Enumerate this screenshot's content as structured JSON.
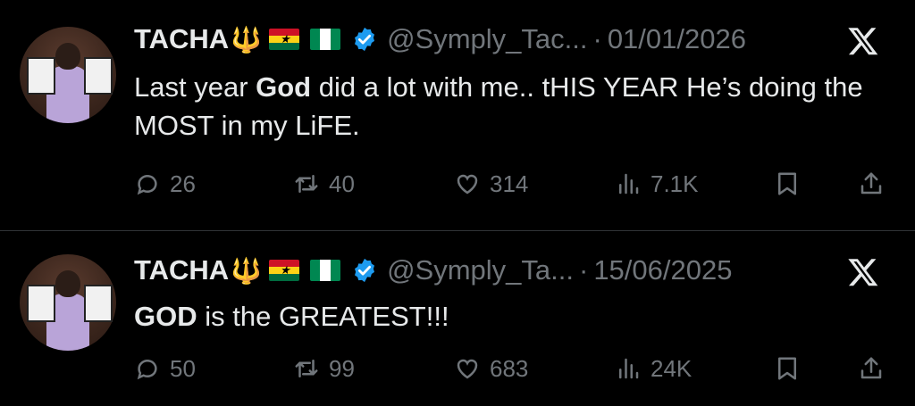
{
  "tweets": [
    {
      "name": "TACHA",
      "emoji": {
        "trident": "🔱"
      },
      "handle": "@Symply_Tac...",
      "separator": "·",
      "date": "01/01/2026",
      "text_parts": [
        {
          "t": "Last year ",
          "b": false
        },
        {
          "t": "God",
          "b": true
        },
        {
          "t": " did a lot with me.. tHIS YEAR He’s doing the MOST in my LiFE.",
          "b": false
        }
      ],
      "replies": "26",
      "reposts": "40",
      "likes": "314",
      "views": "7.1K"
    },
    {
      "name": "TACHA",
      "emoji": {
        "trident": "🔱"
      },
      "handle": "@Symply_Ta...",
      "separator": "·",
      "date": "15/06/2025",
      "text_parts": [
        {
          "t": "GOD",
          "b": true
        },
        {
          "t": " is the GREATEST!!!",
          "b": false
        }
      ],
      "replies": "50",
      "reposts": "99",
      "likes": "683",
      "views": "24K"
    }
  ],
  "icons": [
    "avatar-photo",
    "trident-emoji",
    "ghana-flag",
    "nigeria-flag",
    "verified-badge",
    "x-logo",
    "reply-icon",
    "repost-icon",
    "like-icon",
    "views-icon",
    "bookmark-icon",
    "share-icon"
  ],
  "colors": {
    "background": "#000000",
    "text": "#e7e9ea",
    "secondary": "#71767b",
    "verified": "#1d9bf0",
    "divider": "#2f3336"
  }
}
